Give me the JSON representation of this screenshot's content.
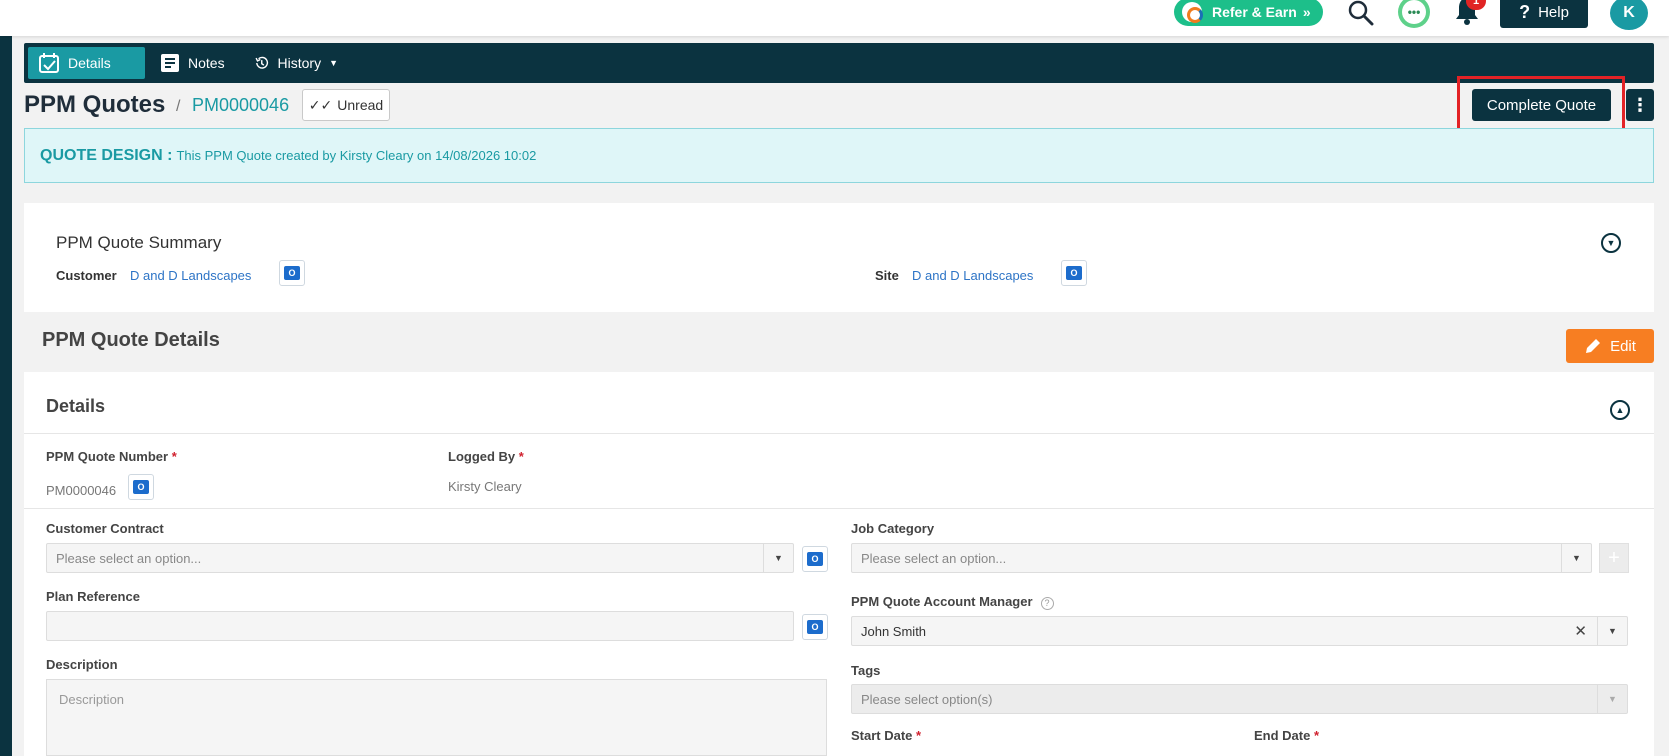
{
  "topbar": {
    "refer_label": "Refer & Earn",
    "refer_arrows": "»",
    "notification_count": "1",
    "help_label": "Help",
    "avatar_initial": "K"
  },
  "tabs": [
    {
      "label": "Details",
      "icon": "calendar-check-icon",
      "active": true
    },
    {
      "label": "Notes",
      "icon": "notes-icon",
      "active": false
    },
    {
      "label": "History",
      "icon": "history-icon",
      "active": false
    }
  ],
  "header": {
    "title": "PPM Quotes",
    "separator": "/",
    "reference": "PM0000046",
    "unread_label": "Unread",
    "complete_label": "Complete Quote"
  },
  "alert": {
    "label": "QUOTE DESIGN :",
    "text": "This PPM Quote created by Kirsty Cleary on 14/08/2026 10:02"
  },
  "summary": {
    "title": "PPM Quote Summary",
    "customer_label": "Customer",
    "customer_value": "D and D Landscapes",
    "site_label": "Site",
    "site_value": "D and D Landscapes"
  },
  "details_section": {
    "heading": "PPM Quote Details",
    "edit_label": "Edit",
    "card_title": "Details"
  },
  "fields": {
    "quote_number_label": "PPM Quote Number",
    "quote_number_value": "PM0000046",
    "logged_by_label": "Logged By",
    "logged_by_value": "Kirsty Cleary",
    "customer_contract_label": "Customer Contract",
    "customer_contract_placeholder": "Please select an option...",
    "job_category_label": "Job Category",
    "job_category_placeholder": "Please select an option...",
    "plan_reference_label": "Plan Reference",
    "plan_reference_value": "",
    "account_manager_label": "PPM Quote Account Manager",
    "account_manager_value": "John Smith",
    "description_label": "Description",
    "description_placeholder": "Description",
    "tags_label": "Tags",
    "tags_placeholder": "Please select option(s)",
    "start_date_label": "Start Date",
    "end_date_label": "End Date",
    "required_mark": "*"
  },
  "colors": {
    "dark_teal": "#0b3340",
    "accent_teal": "#1a9aa3",
    "orange": "#f77e22",
    "link_blue": "#2d74c6",
    "highlight_red": "#e32226"
  }
}
